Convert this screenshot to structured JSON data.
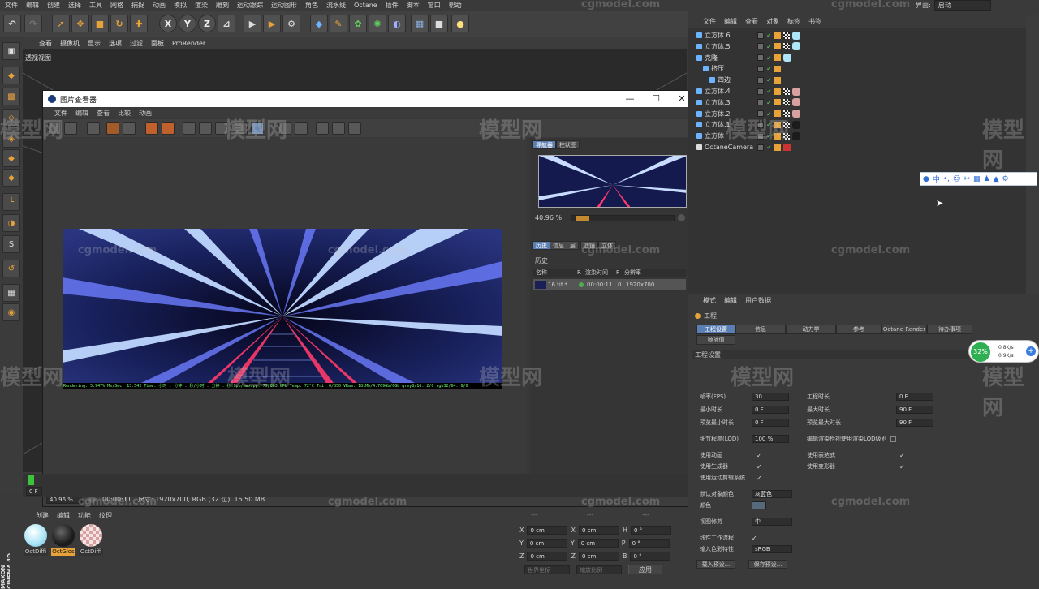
{
  "menubar": [
    "文件",
    "编辑",
    "创建",
    "选择",
    "工具",
    "网格",
    "捕捉",
    "动画",
    "模拟",
    "渲染",
    "雕刻",
    "运动跟踪",
    "运动图形",
    "角色",
    "流水线",
    "Octane",
    "插件",
    "脚本",
    "窗口",
    "帮助"
  ],
  "layout": {
    "label": "界面:",
    "value": "启动"
  },
  "viewport_menu": [
    "查看",
    "摄像机",
    "显示",
    "选项",
    "过滤",
    "面板",
    "ProRender"
  ],
  "viewport_label": "透视视图",
  "axes": [
    "X",
    "Y",
    "Z"
  ],
  "picture_viewer": {
    "title": "图片查看器",
    "menu": [
      "文件",
      "编辑",
      "查看",
      "比较",
      "动画"
    ],
    "render_status": "Rendering: 5.947%  Ms/Sec: 13.542  Time: 小时 : 分钟 : 秒/小时 : 分钟 : 秒  Spp/maxspp: 79/883  GPU  Temp: 72°C  Tri: 0/850  VRam: 181Mb/4.709Gb/6Gb  grey8/16: 2/0  rgb32/64: 0/0",
    "nav_tabs": [
      "导航器",
      "柱状图"
    ],
    "nav_zoom": "40.96 %",
    "info_tabs": [
      "历史",
      "信息",
      "层",
      "滤镜",
      "立体"
    ],
    "history_label": "历史",
    "history_cols": [
      "名称",
      "R",
      "渲染时间",
      "F",
      "分辨率"
    ],
    "history_row": {
      "name": "16.tif *",
      "time": "00:00:11",
      "frame": "0",
      "res": "1920x700"
    },
    "footer": {
      "zoom": "40.96 %",
      "time": "00:00:11",
      "info": "尺寸: 1920x700, RGB (32 位), 15.50 MB"
    }
  },
  "timeline": {
    "frame": "0 F"
  },
  "materials": {
    "menu": [
      "创建",
      "编辑",
      "功能",
      "纹理"
    ],
    "items": [
      {
        "name": "OctDiffi",
        "color": "#aee6f7"
      },
      {
        "name": "OctGlos",
        "color": "#1b1b1b"
      },
      {
        "name": "OctDiffi",
        "color": "#d9a0a0"
      }
    ]
  },
  "coords": {
    "header": [
      "---",
      "---",
      "---"
    ],
    "rows": [
      {
        "a": "X",
        "av": "0 cm",
        "b": "X",
        "bv": "0 cm",
        "c": "H",
        "cv": "0 °"
      },
      {
        "a": "Y",
        "av": "0 cm",
        "b": "Y",
        "bv": "0 cm",
        "c": "P",
        "cv": "0 °"
      },
      {
        "a": "Z",
        "av": "0 cm",
        "b": "Z",
        "bv": "0 cm",
        "c": "B",
        "cv": "0 °"
      }
    ],
    "mode1": "世界坐标",
    "mode2": "缩放比例",
    "apply": "应用"
  },
  "objects": {
    "menu": [
      "文件",
      "编辑",
      "查看",
      "对象",
      "标签",
      "书签"
    ],
    "rows": [
      {
        "name": "立方体.6",
        "indent": 0
      },
      {
        "name": "立方体.5",
        "indent": 0
      },
      {
        "name": "克隆",
        "indent": 0
      },
      {
        "name": "挤压",
        "indent": 1
      },
      {
        "name": "四边",
        "indent": 2
      },
      {
        "name": "立方体.4",
        "indent": 0
      },
      {
        "name": "立方体.3",
        "indent": 0
      },
      {
        "name": "立方体.2",
        "indent": 0
      },
      {
        "name": "立方体.1",
        "indent": 0
      },
      {
        "name": "立方体",
        "indent": 0
      },
      {
        "name": "OctaneCamera",
        "indent": 0
      }
    ]
  },
  "attributes": {
    "menu": [
      "模式",
      "编辑",
      "用户数据"
    ],
    "title": "工程",
    "tabs": [
      "工程设置",
      "信息",
      "动力学",
      "参考",
      "Octane Render",
      "待办事项",
      "帧插值"
    ],
    "section": "工程设置",
    "fields_left": [
      {
        "k": "帧率(FPS)",
        "v": "30"
      },
      {
        "k": "最小时长",
        "v": "0 F"
      },
      {
        "k": "预览最小时长",
        "v": "0 F"
      }
    ],
    "fields_right": [
      {
        "k": "工程时长",
        "v": "0 F"
      },
      {
        "k": "最大时长",
        "v": "90 F"
      },
      {
        "k": "预览最大时长",
        "v": "90 F"
      }
    ],
    "lod_label": "细节程度(LOD)",
    "lod_value": "100 %",
    "lod_right": "编辑渲染检视使用渲染LOD级别",
    "checks_left": [
      "使用动画",
      "使用生成器",
      "使用运动剪辑系统"
    ],
    "checks_right": [
      "使用表达式",
      "使用变形器"
    ],
    "default_color_label": "默认对象颜色",
    "default_color_value": "灰蓝色",
    "color_label": "颜色",
    "view_clip_label": "视图修剪",
    "view_clip_value": "中",
    "linear_label": "线性工作流程",
    "input_color_label": "输入色彩特性",
    "input_color_value": "sRGB",
    "load_preset": "载入预设...",
    "save_preset": "保存预设..."
  },
  "network": {
    "percent": "32%",
    "up": "0.8K/s",
    "down": "0.9K/s"
  },
  "watermark_cn": "模型网",
  "watermark_en": "cgmodel.com",
  "brand": "MAXON CINEMA 4D"
}
